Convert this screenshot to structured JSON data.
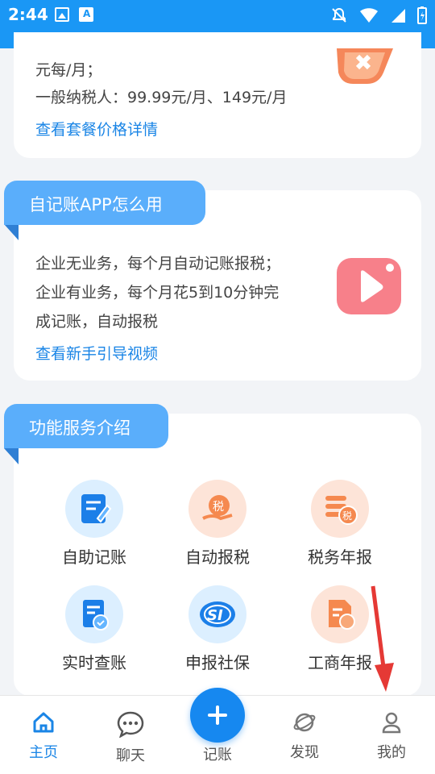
{
  "status_bar": {
    "time": "2:44"
  },
  "pricing_card": {
    "line1": "元每/月；",
    "line2": "一般纳税人：99.99元/月、149元/月",
    "link": "查看套餐价格详情"
  },
  "guide_card": {
    "title": "自记账APP怎么用",
    "line1": "企业无业务，每个月自动记账报税；",
    "line2": "企业有业务，每个月花5到10分钟完",
    "line3": "成记账，自动报税",
    "link": "查看新手引导视频"
  },
  "features_card": {
    "title": "功能服务介绍",
    "items": [
      {
        "label": "自助记账",
        "icon": "bookkeeping-icon"
      },
      {
        "label": "自动报税",
        "icon": "tax-filing-icon"
      },
      {
        "label": "税务年报",
        "icon": "tax-annual-report-icon"
      },
      {
        "label": "实时查账",
        "icon": "realtime-audit-icon"
      },
      {
        "label": "申报社保",
        "icon": "social-security-icon"
      },
      {
        "label": "工商年报",
        "icon": "business-annual-report-icon"
      }
    ]
  },
  "bottom_nav": {
    "items": [
      {
        "label": "主页",
        "icon": "home-icon",
        "active": true
      },
      {
        "label": "聊天",
        "icon": "chat-icon",
        "active": false
      },
      {
        "label": "记账",
        "icon": "plus-icon",
        "active": false
      },
      {
        "label": "发现",
        "icon": "planet-icon",
        "active": false
      },
      {
        "label": "我的",
        "icon": "user-icon",
        "active": false
      }
    ]
  },
  "colors": {
    "primary": "#1a97f5",
    "accent_red": "#e53935",
    "video_pink": "#f7808a"
  }
}
